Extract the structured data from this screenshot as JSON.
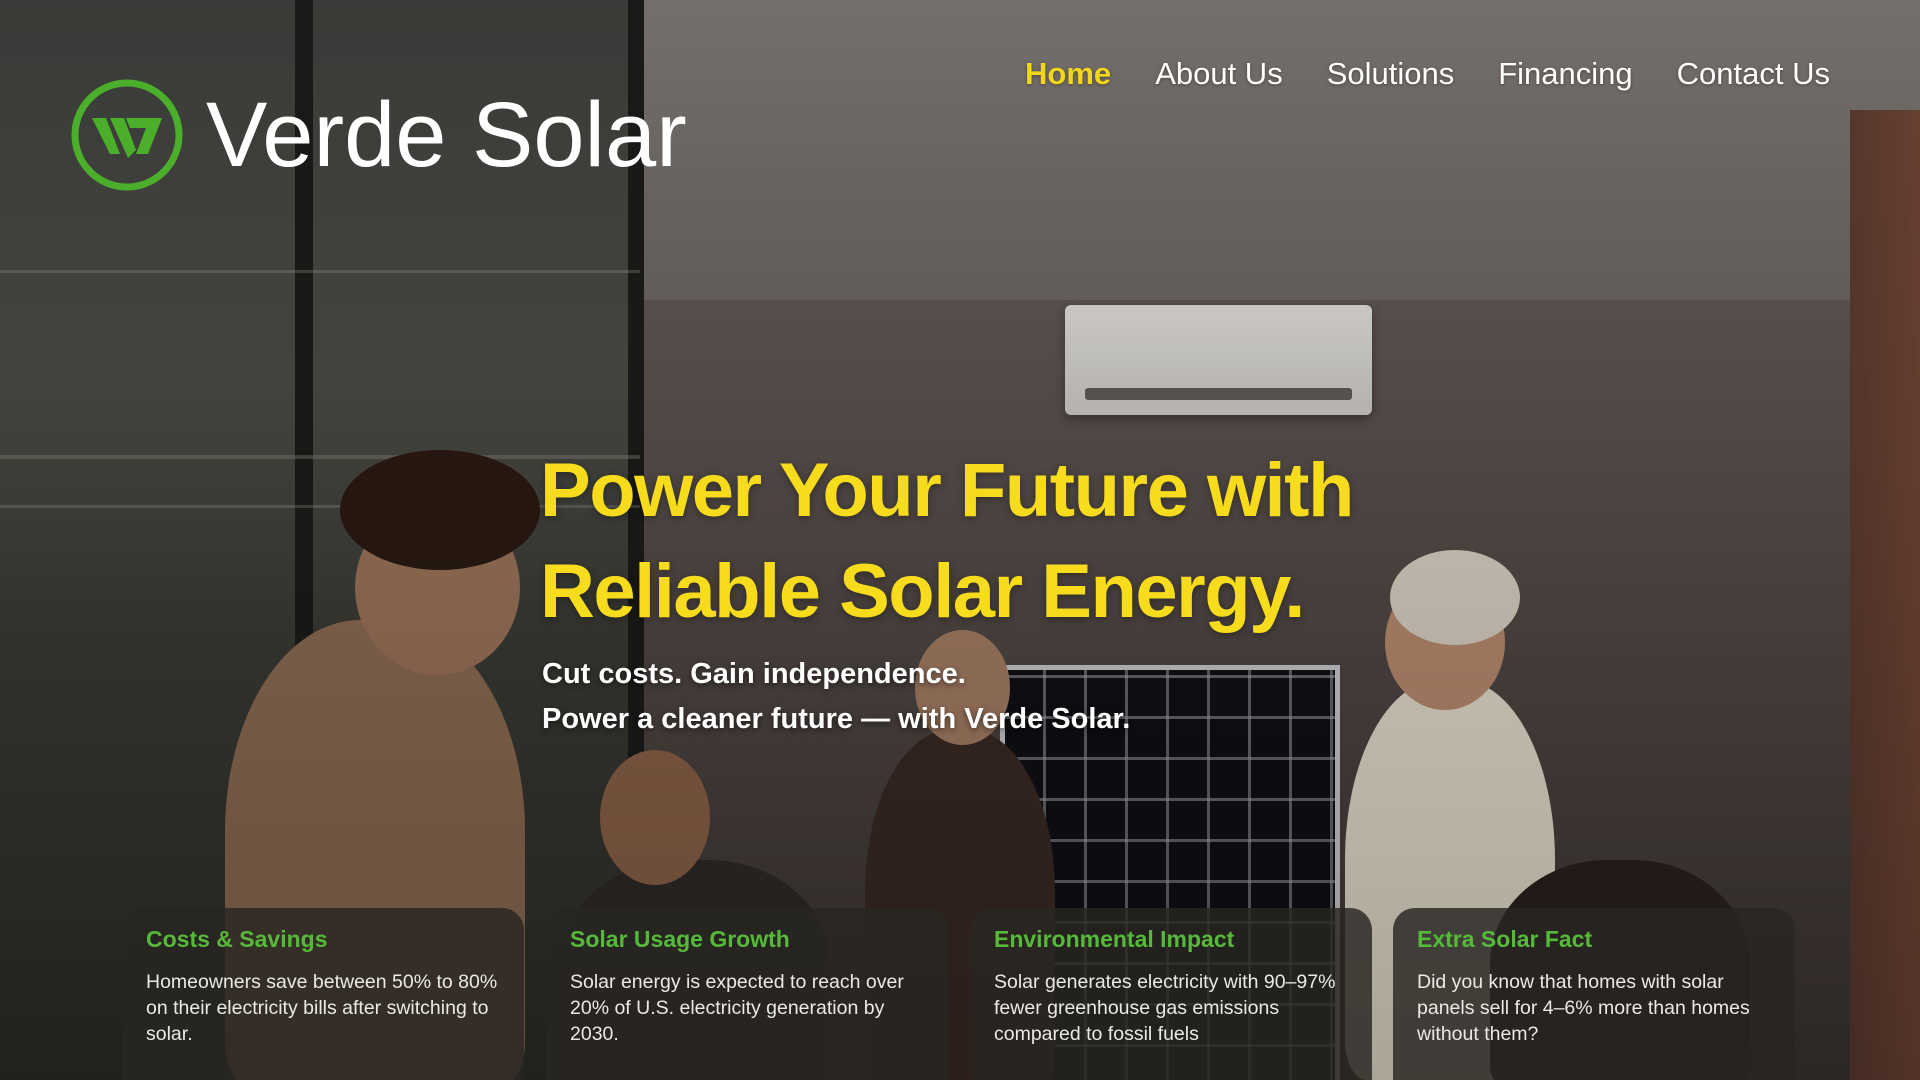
{
  "brand": {
    "name": "Verde Solar",
    "logo_icon": "vs-leaf-circle-icon",
    "accent_color": "#4caf2c"
  },
  "nav": {
    "items": [
      {
        "label": "Home",
        "active": true
      },
      {
        "label": "About Us",
        "active": false
      },
      {
        "label": "Solutions",
        "active": false
      },
      {
        "label": "Financing",
        "active": false
      },
      {
        "label": "Contact Us",
        "active": false
      }
    ],
    "active_color": "#f2d718"
  },
  "hero": {
    "headline_line1": "Power Your Future with",
    "headline_line2": "Reliable Solar Energy.",
    "headline_color": "#f6dc1c",
    "subhead_line1": "Cut costs. Gain independence.",
    "subhead_line2": "Power a cleaner future — with Verde Solar."
  },
  "cards": [
    {
      "title": "Costs & Savings",
      "body": "Homeowners save between 50% to 80% on their electricity bills after switching to solar."
    },
    {
      "title": "Solar Usage Growth",
      "body": "Solar energy is expected to reach over 20% of U.S. electricity generation by 2030."
    },
    {
      "title": "Environmental Impact",
      "body": "Solar generates electricity with 90–97% fewer greenhouse gas emissions compared to fossil fuels"
    },
    {
      "title": "Extra Solar Fact",
      "body": "Did you know that homes with solar panels sell for 4–6% more than homes without them?"
    }
  ],
  "card_title_color": "#56b93a"
}
